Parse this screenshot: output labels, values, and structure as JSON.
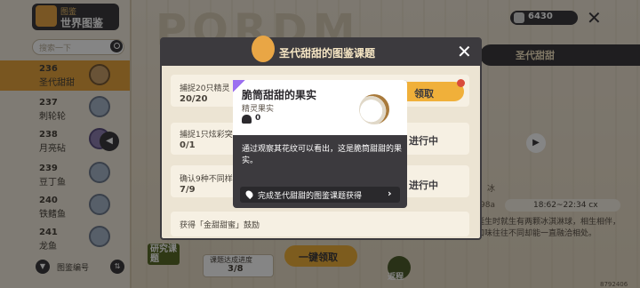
{
  "header": {
    "logo_small": "图鉴",
    "logo_title": "世界图鉴",
    "coins": "6430"
  },
  "sidebar": {
    "search_placeholder": "搜索一下",
    "items": [
      {
        "number": "236",
        "name": "圣代甜甜"
      },
      {
        "number": "237",
        "name": "刺轮轮"
      },
      {
        "number": "238",
        "name": "月亮砧"
      },
      {
        "number": "239",
        "name": "豆丁鱼"
      },
      {
        "number": "240",
        "name": "铁鳍鱼"
      },
      {
        "number": "241",
        "name": "龙鱼"
      }
    ],
    "filter_label": "图鉴编号"
  },
  "background": {
    "right_title": "圣代甜甜",
    "env": "冰",
    "time": "18:62~22:34 cx",
    "small_98": "98a",
    "lore": "奇，圣代甜甜诞生时就生有两颗冰淇淋球，相生相伴，两颗冰淇淋球口味往往不同却能一直融洽相处。",
    "research_label": "研究课题",
    "progress_label": "课题达成进度",
    "progress_value": "3/8",
    "one_key_claim": "一键领取",
    "return_label": "返程",
    "uid": "8792406"
  },
  "modal": {
    "title": "圣代甜甜的图鉴课题",
    "tasks": [
      {
        "text": "捕捉20只精灵",
        "progress": "20/20",
        "action": "领取"
      },
      {
        "text": "捕捉1只炫彩突变",
        "progress": "0/1",
        "action": "进行中"
      },
      {
        "text": "确认9种不同样子",
        "progress": "7/9",
        "action": "进行中"
      },
      {
        "text": "获得「金甜甜蜜」鼓励",
        "progress": "",
        "action": ""
      }
    ]
  },
  "popup": {
    "title": "脆筒甜甜的果实",
    "subtitle": "精灵果实",
    "count": "0",
    "description": "通过观察其花纹可以看出，这是脆筒甜甜的果实。",
    "source": "完成圣代甜甜的图鉴课题获得"
  },
  "colors": {
    "accent": "#f0b03a",
    "dark": "#3c3a3e",
    "rare_purple": "#9b6ff0",
    "badge_red": "#d94b3c"
  }
}
